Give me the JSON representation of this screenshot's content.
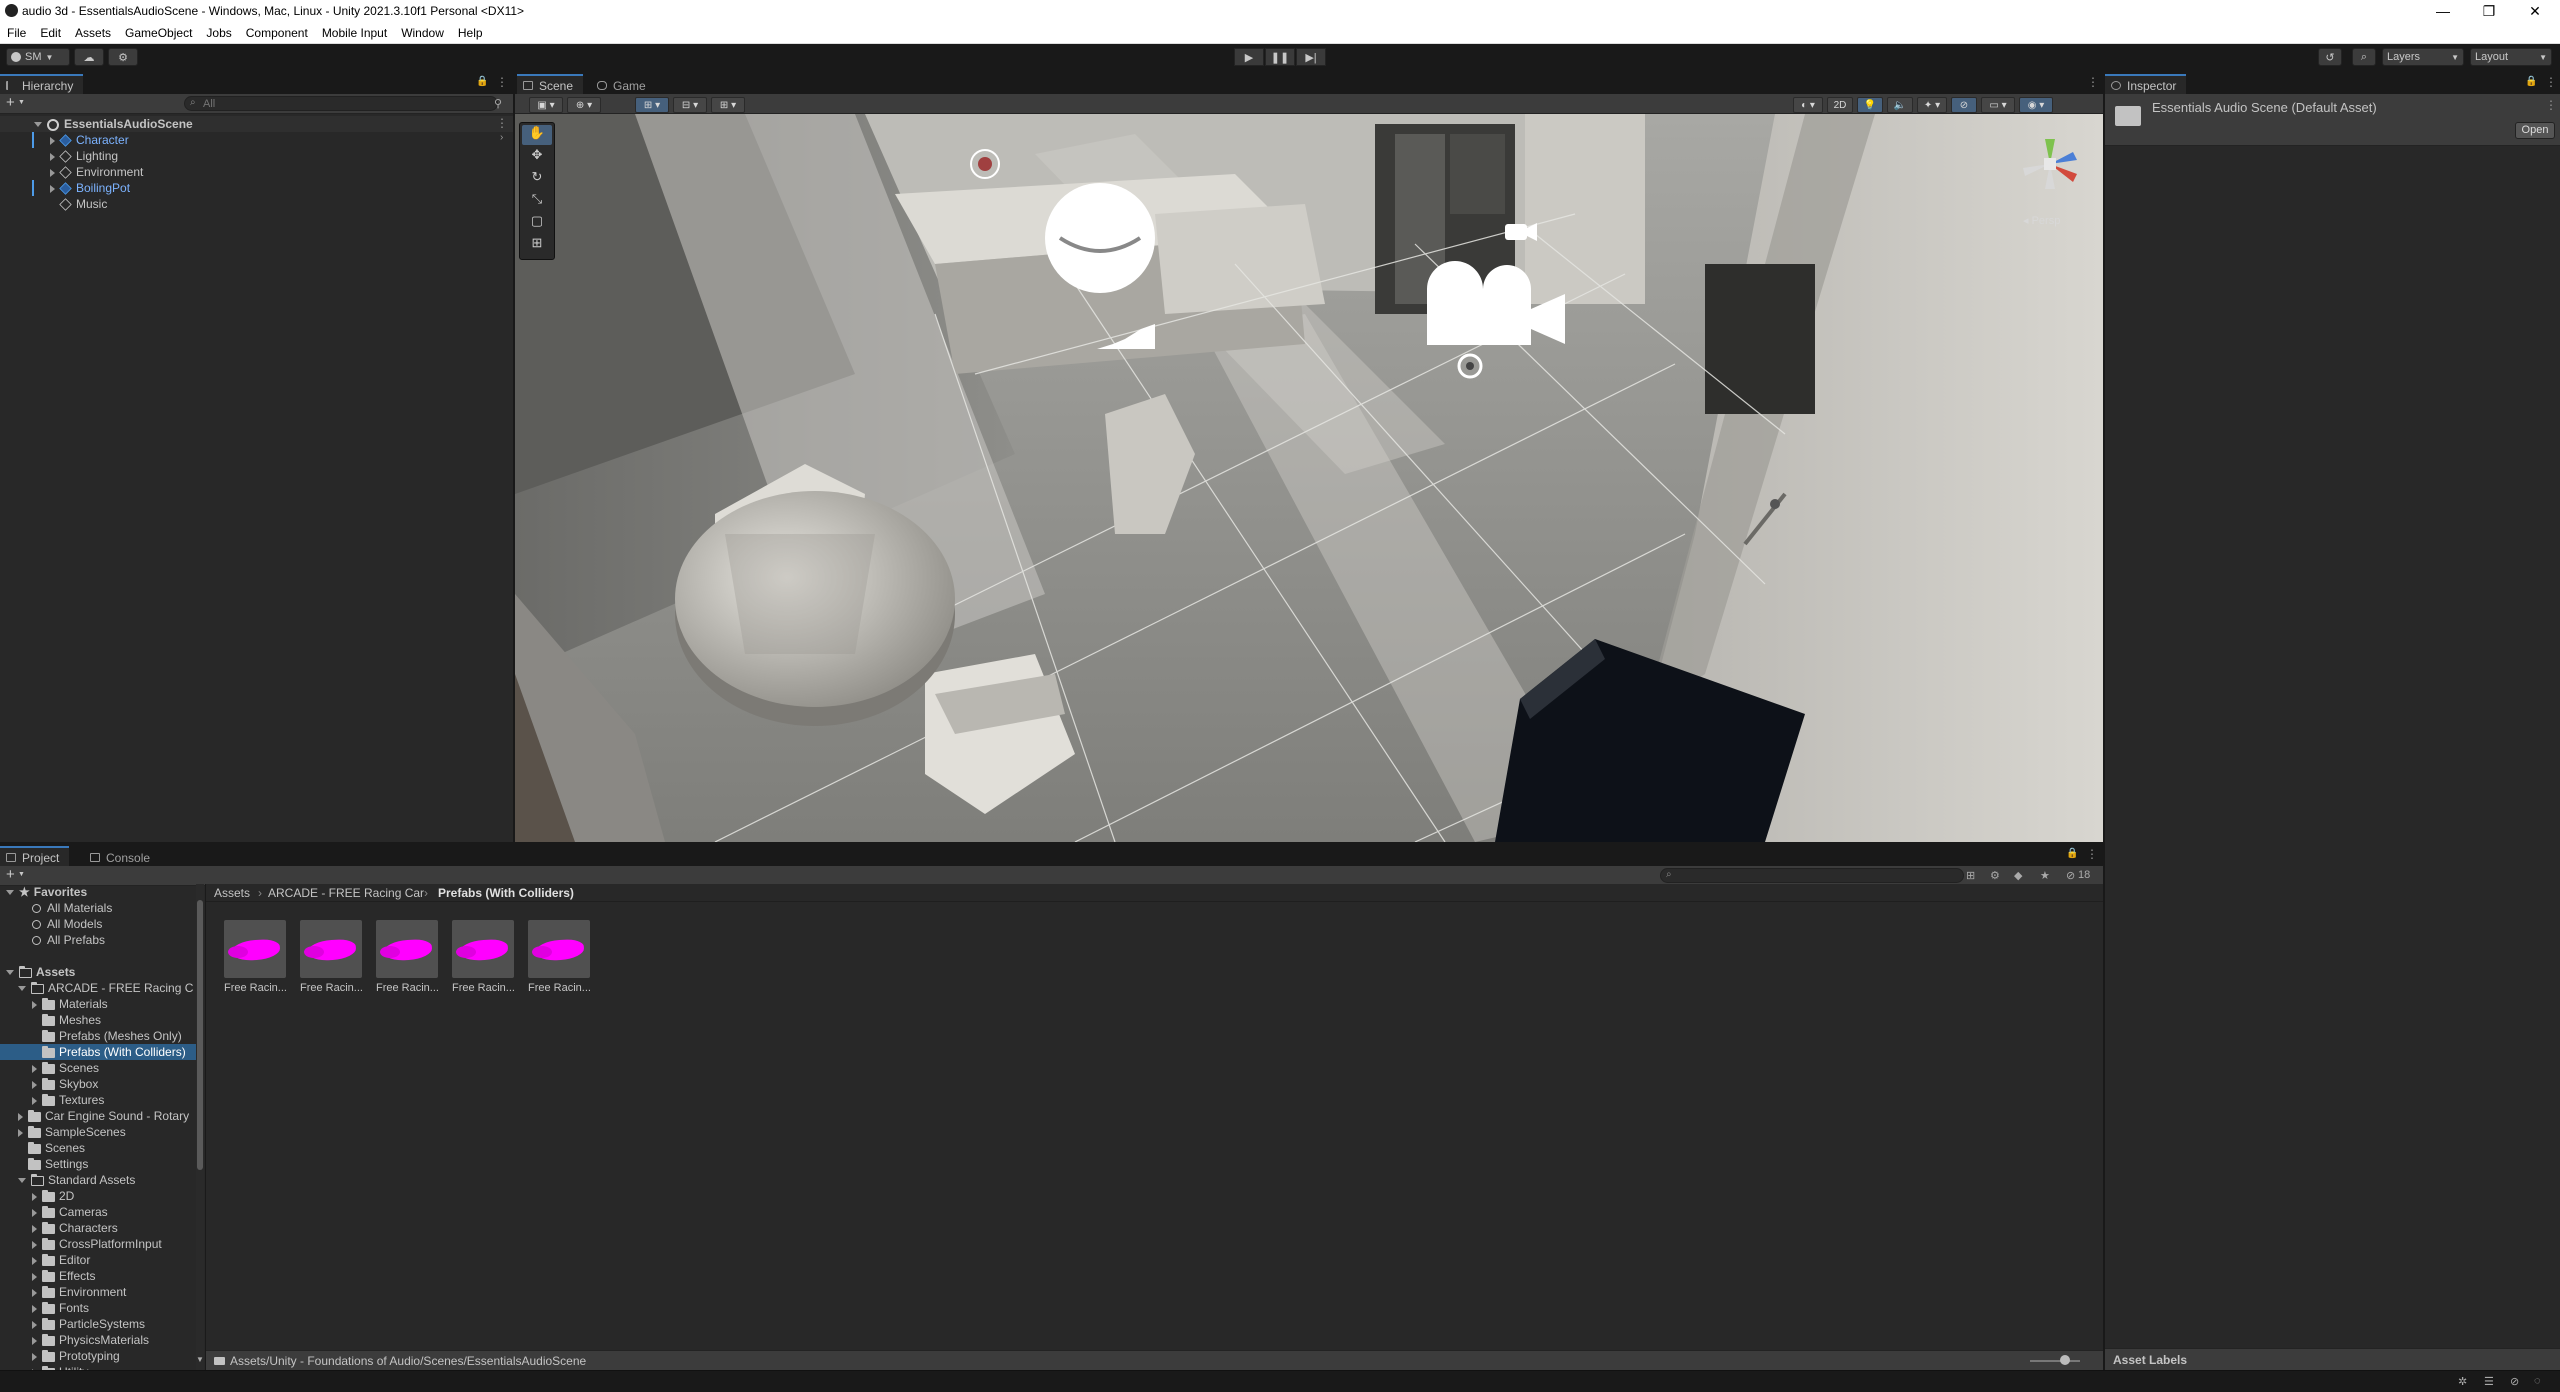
{
  "window": {
    "title": "audio 3d - EssentialsAudioScene - Windows, Mac, Linux - Unity 2021.3.10f1 Personal <DX11>",
    "minimize": "—",
    "maximize": "❐",
    "close": "✕"
  },
  "menu": [
    "File",
    "Edit",
    "Assets",
    "GameObject",
    "Jobs",
    "Component",
    "Mobile Input",
    "Window",
    "Help"
  ],
  "toolbar": {
    "account": "SM",
    "layers": "Layers",
    "layout": "Layout"
  },
  "hierarchy": {
    "tab": "Hierarchy",
    "search_placeholder": "All",
    "scene": "EssentialsAudioScene",
    "items": [
      {
        "label": "Character",
        "prefab": true,
        "expandable": true
      },
      {
        "label": "Lighting",
        "prefab": false,
        "expandable": true
      },
      {
        "label": "Environment",
        "prefab": false,
        "expandable": true
      },
      {
        "label": "BoilingPot",
        "prefab": true,
        "expandable": true
      },
      {
        "label": "Music",
        "prefab": false,
        "expandable": false
      }
    ]
  },
  "sceneview": {
    "tabs": [
      "Scene",
      "Game"
    ],
    "mode_2d": "2D",
    "persp": "Persp"
  },
  "inspector": {
    "tab": "Inspector",
    "title": "Essentials Audio Scene (Default Asset)",
    "open_button": "Open",
    "asset_labels": "Asset Labels"
  },
  "project": {
    "tabs": [
      "Project",
      "Console"
    ],
    "count_badge": "18",
    "favorites_label": "Favorites",
    "favorites": [
      "All Materials",
      "All Models",
      "All Prefabs"
    ],
    "assets_label": "Assets",
    "tree": [
      {
        "label": "ARCADE - FREE Racing C",
        "depth": 1,
        "open": true,
        "selected": false,
        "expandable": true
      },
      {
        "label": "Materials",
        "depth": 2,
        "open": false,
        "selected": false,
        "expandable": true
      },
      {
        "label": "Meshes",
        "depth": 2,
        "open": false,
        "selected": false,
        "expandable": false
      },
      {
        "label": "Prefabs (Meshes Only)",
        "depth": 2,
        "open": false,
        "selected": false,
        "expandable": false
      },
      {
        "label": "Prefabs (With Colliders)",
        "depth": 2,
        "open": false,
        "selected": true,
        "expandable": false
      },
      {
        "label": "Scenes",
        "depth": 2,
        "open": false,
        "selected": false,
        "expandable": true
      },
      {
        "label": "Skybox",
        "depth": 2,
        "open": false,
        "selected": false,
        "expandable": true
      },
      {
        "label": "Textures",
        "depth": 2,
        "open": false,
        "selected": false,
        "expandable": true
      },
      {
        "label": "Car Engine Sound - Rotary",
        "depth": 1,
        "open": false,
        "selected": false,
        "expandable": true
      },
      {
        "label": "SampleScenes",
        "depth": 1,
        "open": false,
        "selected": false,
        "expandable": true
      },
      {
        "label": "Scenes",
        "depth": 1,
        "open": false,
        "selected": false,
        "expandable": false
      },
      {
        "label": "Settings",
        "depth": 1,
        "open": false,
        "selected": false,
        "expandable": false
      },
      {
        "label": "Standard Assets",
        "depth": 1,
        "open": true,
        "selected": false,
        "expandable": true
      },
      {
        "label": "2D",
        "depth": 2,
        "open": false,
        "selected": false,
        "expandable": true
      },
      {
        "label": "Cameras",
        "depth": 2,
        "open": false,
        "selected": false,
        "expandable": true
      },
      {
        "label": "Characters",
        "depth": 2,
        "open": false,
        "selected": false,
        "expandable": true
      },
      {
        "label": "CrossPlatformInput",
        "depth": 2,
        "open": false,
        "selected": false,
        "expandable": true
      },
      {
        "label": "Editor",
        "depth": 2,
        "open": false,
        "selected": false,
        "expandable": true
      },
      {
        "label": "Effects",
        "depth": 2,
        "open": false,
        "selected": false,
        "expandable": true
      },
      {
        "label": "Environment",
        "depth": 2,
        "open": false,
        "selected": false,
        "expandable": true
      },
      {
        "label": "Fonts",
        "depth": 2,
        "open": false,
        "selected": false,
        "expandable": true
      },
      {
        "label": "ParticleSystems",
        "depth": 2,
        "open": false,
        "selected": false,
        "expandable": true
      },
      {
        "label": "PhysicsMaterials",
        "depth": 2,
        "open": false,
        "selected": false,
        "expandable": true
      },
      {
        "label": "Prototyping",
        "depth": 2,
        "open": false,
        "selected": false,
        "expandable": true
      },
      {
        "label": "Utility",
        "depth": 2,
        "open": false,
        "selected": false,
        "expandable": true
      }
    ],
    "breadcrumb": [
      "Assets",
      "ARCADE - FREE Racing Car",
      "Prefabs (With Colliders)"
    ],
    "assets": [
      "Free Racin...",
      "Free Racin...",
      "Free Racin...",
      "Free Racin...",
      "Free Racin..."
    ],
    "path": "Assets/Unity - Foundations of Audio/Scenes/EssentialsAudioScene"
  }
}
